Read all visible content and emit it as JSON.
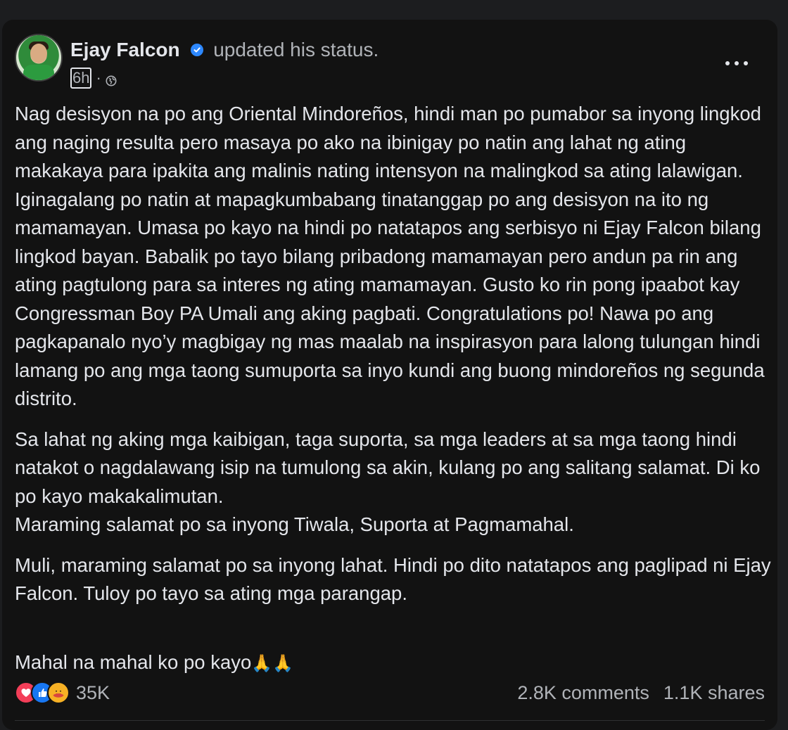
{
  "post": {
    "author": "Ejay Falcon",
    "action": "updated his status.",
    "time": "6h",
    "separator": "·",
    "audience_icon": "globe-icon",
    "menu_icon": "more-horizontal-icon",
    "paragraphs": [
      "Nag desisyon na po ang Oriental Mindoreños, hindi man po pumabor sa inyong lingkod ang naging resulta pero masaya po ako na ibinigay po natin ang lahat ng ating makakaya para ipakita ang malinis nating intensyon na malingkod sa ating lalawigan. Iginagalang po natin at mapagkumbabang tinatanggap po ang desisyon na ito ng mamamayan. Umasa po kayo na hindi po natatapos ang serbisyo ni Ejay Falcon bilang lingkod bayan. Babalik po tayo bilang pribadong mamamayan pero andun pa rin ang ating pagtulong para sa interes ng ating mamamayan. Gusto ko rin pong ipaabot kay Congressman Boy PA Umali ang aking pagbati. Congratulations po! Nawa po ang pagkapanalo nyo’y magbigay ng mas maalab na inspirasyon para lalong tulungan hindi lamang po ang mga taong sumuporta sa inyo kundi ang buong mindoreños ng segunda distrito.",
      "Sa lahat ng aking mga kaibigan, taga suporta, sa mga leaders at sa mga taong hindi natakot o nagdalawang isip na tumulong sa akin, kulang po ang salitang salamat. Di ko po kayo makakalimutan.\nMaraming salamat po sa inyong Tiwala, Suporta at Pagmamahal.",
      "Muli, maraming salamat po sa inyong lahat. Hindi po dito natatapos ang paglipad ni Ejay Falcon. Tuloy po tayo sa ating mga parangap.",
      "Mahal na mahal ko po kayo"
    ],
    "closing_emoji": "🙏🙏",
    "reactions": {
      "icons": [
        "love-icon",
        "like-icon",
        "care-icon"
      ],
      "count": "35K"
    },
    "comments": "2.8K comments",
    "shares": "1.1K shares"
  },
  "colors": {
    "background": "#121212",
    "text": "#e4e6eb",
    "secondary_text": "#b0b3b8",
    "verified": "#2d88ff",
    "love": "#f33e58",
    "like": "#1877f2",
    "care": "#f7b125"
  }
}
